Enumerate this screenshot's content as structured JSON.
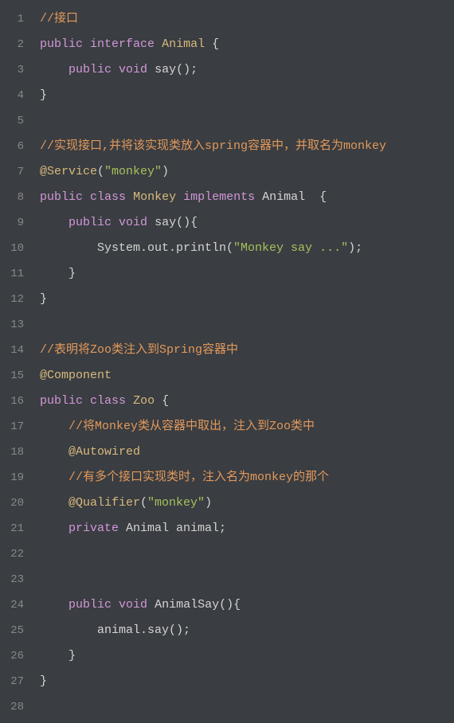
{
  "lines": [
    {
      "num": "1",
      "indent": 0,
      "tokens": [
        {
          "cls": "comment",
          "t": "//接口"
        }
      ]
    },
    {
      "num": "2",
      "indent": 0,
      "tokens": [
        {
          "cls": "keyword",
          "t": "public"
        },
        {
          "cls": "default",
          "t": " "
        },
        {
          "cls": "keyword",
          "t": "interface"
        },
        {
          "cls": "default",
          "t": " "
        },
        {
          "cls": "type",
          "t": "Animal"
        },
        {
          "cls": "default",
          "t": " {"
        }
      ]
    },
    {
      "num": "3",
      "indent": 1,
      "tokens": [
        {
          "cls": "keyword",
          "t": "public"
        },
        {
          "cls": "default",
          "t": " "
        },
        {
          "cls": "keyword",
          "t": "void"
        },
        {
          "cls": "default",
          "t": " say();"
        }
      ]
    },
    {
      "num": "4",
      "indent": 0,
      "tokens": [
        {
          "cls": "default",
          "t": "}"
        }
      ]
    },
    {
      "num": "5",
      "indent": 0,
      "tokens": []
    },
    {
      "num": "6",
      "indent": 0,
      "tokens": [
        {
          "cls": "comment",
          "t": "//实现接口,并将该实现类放入spring容器中，并取名为monkey"
        }
      ]
    },
    {
      "num": "7",
      "indent": 0,
      "tokens": [
        {
          "cls": "annotation",
          "t": "@Service"
        },
        {
          "cls": "default",
          "t": "("
        },
        {
          "cls": "string",
          "t": "\"monkey\""
        },
        {
          "cls": "default",
          "t": ")"
        }
      ]
    },
    {
      "num": "8",
      "indent": 0,
      "tokens": [
        {
          "cls": "keyword",
          "t": "public"
        },
        {
          "cls": "default",
          "t": " "
        },
        {
          "cls": "keyword",
          "t": "class"
        },
        {
          "cls": "default",
          "t": " "
        },
        {
          "cls": "type",
          "t": "Monkey"
        },
        {
          "cls": "default",
          "t": " "
        },
        {
          "cls": "keyword",
          "t": "implements"
        },
        {
          "cls": "default",
          "t": " Animal  {"
        }
      ]
    },
    {
      "num": "9",
      "indent": 1,
      "tokens": [
        {
          "cls": "keyword",
          "t": "public"
        },
        {
          "cls": "default",
          "t": " "
        },
        {
          "cls": "keyword",
          "t": "void"
        },
        {
          "cls": "default",
          "t": " say(){"
        }
      ]
    },
    {
      "num": "10",
      "indent": 2,
      "tokens": [
        {
          "cls": "default",
          "t": "System.out.println("
        },
        {
          "cls": "string",
          "t": "\"Monkey say ...\""
        },
        {
          "cls": "default",
          "t": ");"
        }
      ]
    },
    {
      "num": "11",
      "indent": 1,
      "tokens": [
        {
          "cls": "default",
          "t": "}"
        }
      ]
    },
    {
      "num": "12",
      "indent": 0,
      "tokens": [
        {
          "cls": "default",
          "t": "}"
        }
      ]
    },
    {
      "num": "13",
      "indent": 0,
      "tokens": []
    },
    {
      "num": "14",
      "indent": 0,
      "tokens": [
        {
          "cls": "comment",
          "t": "//表明将Zoo类注入到Spring容器中"
        }
      ]
    },
    {
      "num": "15",
      "indent": 0,
      "tokens": [
        {
          "cls": "annotation",
          "t": "@Component"
        }
      ]
    },
    {
      "num": "16",
      "indent": 0,
      "tokens": [
        {
          "cls": "keyword",
          "t": "public"
        },
        {
          "cls": "default",
          "t": " "
        },
        {
          "cls": "keyword",
          "t": "class"
        },
        {
          "cls": "default",
          "t": " "
        },
        {
          "cls": "type",
          "t": "Zoo"
        },
        {
          "cls": "default",
          "t": " {"
        }
      ]
    },
    {
      "num": "17",
      "indent": 1,
      "tokens": [
        {
          "cls": "comment",
          "t": "//将Monkey类从容器中取出，注入到Zoo类中"
        }
      ]
    },
    {
      "num": "18",
      "indent": 1,
      "tokens": [
        {
          "cls": "annotation",
          "t": "@Autowired"
        }
      ]
    },
    {
      "num": "19",
      "indent": 1,
      "tokens": [
        {
          "cls": "comment",
          "t": "//有多个接口实现类时，注入名为monkey的那个"
        }
      ]
    },
    {
      "num": "20",
      "indent": 1,
      "tokens": [
        {
          "cls": "annotation",
          "t": "@Qualifier"
        },
        {
          "cls": "default",
          "t": "("
        },
        {
          "cls": "string",
          "t": "\"monkey\""
        },
        {
          "cls": "default",
          "t": ")"
        }
      ]
    },
    {
      "num": "21",
      "indent": 1,
      "tokens": [
        {
          "cls": "keyword",
          "t": "private"
        },
        {
          "cls": "default",
          "t": " Animal animal;"
        }
      ]
    },
    {
      "num": "22",
      "indent": 0,
      "tokens": []
    },
    {
      "num": "23",
      "indent": 0,
      "tokens": []
    },
    {
      "num": "24",
      "indent": 1,
      "tokens": [
        {
          "cls": "keyword",
          "t": "public"
        },
        {
          "cls": "default",
          "t": " "
        },
        {
          "cls": "keyword",
          "t": "void"
        },
        {
          "cls": "default",
          "t": " AnimalSay(){"
        }
      ]
    },
    {
      "num": "25",
      "indent": 2,
      "tokens": [
        {
          "cls": "default",
          "t": "animal.say();"
        }
      ]
    },
    {
      "num": "26",
      "indent": 1,
      "tokens": [
        {
          "cls": "default",
          "t": "}"
        }
      ]
    },
    {
      "num": "27",
      "indent": 0,
      "tokens": [
        {
          "cls": "default",
          "t": "}"
        }
      ]
    },
    {
      "num": "28",
      "indent": 0,
      "tokens": []
    }
  ],
  "indent_unit": "    "
}
